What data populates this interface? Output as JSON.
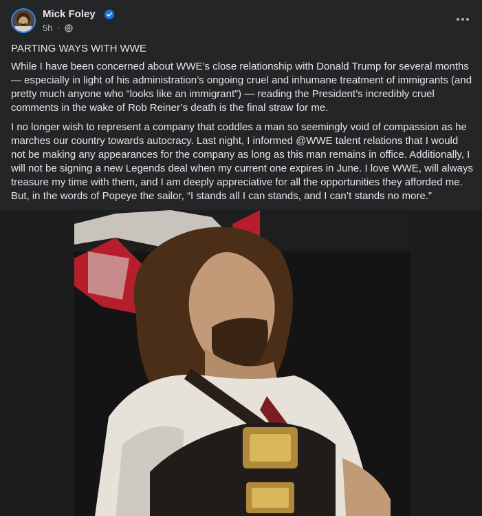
{
  "post": {
    "author": "Mick Foley",
    "time": "5h",
    "separator": "·",
    "title": "PARTING WAYS WITH WWE",
    "paragraphs": [
      "While I have been concerned about WWE’s close relationship with Donald Trump for several months — especially in light of his administration’s ongoing cruel and inhumane treatment of immigrants (and pretty much anyone who “looks like an immigrant”) — reading the President’s incredibly cruel comments in the wake of Rob Reiner’s death is the final straw for me.",
      "I no longer wish to represent a company that coddles a man so seemingly void of compassion as he marches our country towards autocracy.  Last night, I informed @WWE talent relations that I would not be making any appearances for the company as long as this man remains in office. Additionally, I will not be signing a new Legends deal when my current one expires in June. I love WWE, will always treasure my time with them, and I am deeply appreciative for all the opportunities they afforded me. But, in the words of Popeye the sailor, “I stands all I can stands, and I can’t stands no more.”"
    ]
  },
  "icons": {
    "verified": "verified-badge-icon",
    "audience": "globe-icon",
    "menu": "more-options-icon"
  },
  "colors": {
    "background": "#242526",
    "text": "#e4e6eb",
    "secondary_text": "#b0b3b8",
    "verified_blue": "#1b74e4"
  }
}
